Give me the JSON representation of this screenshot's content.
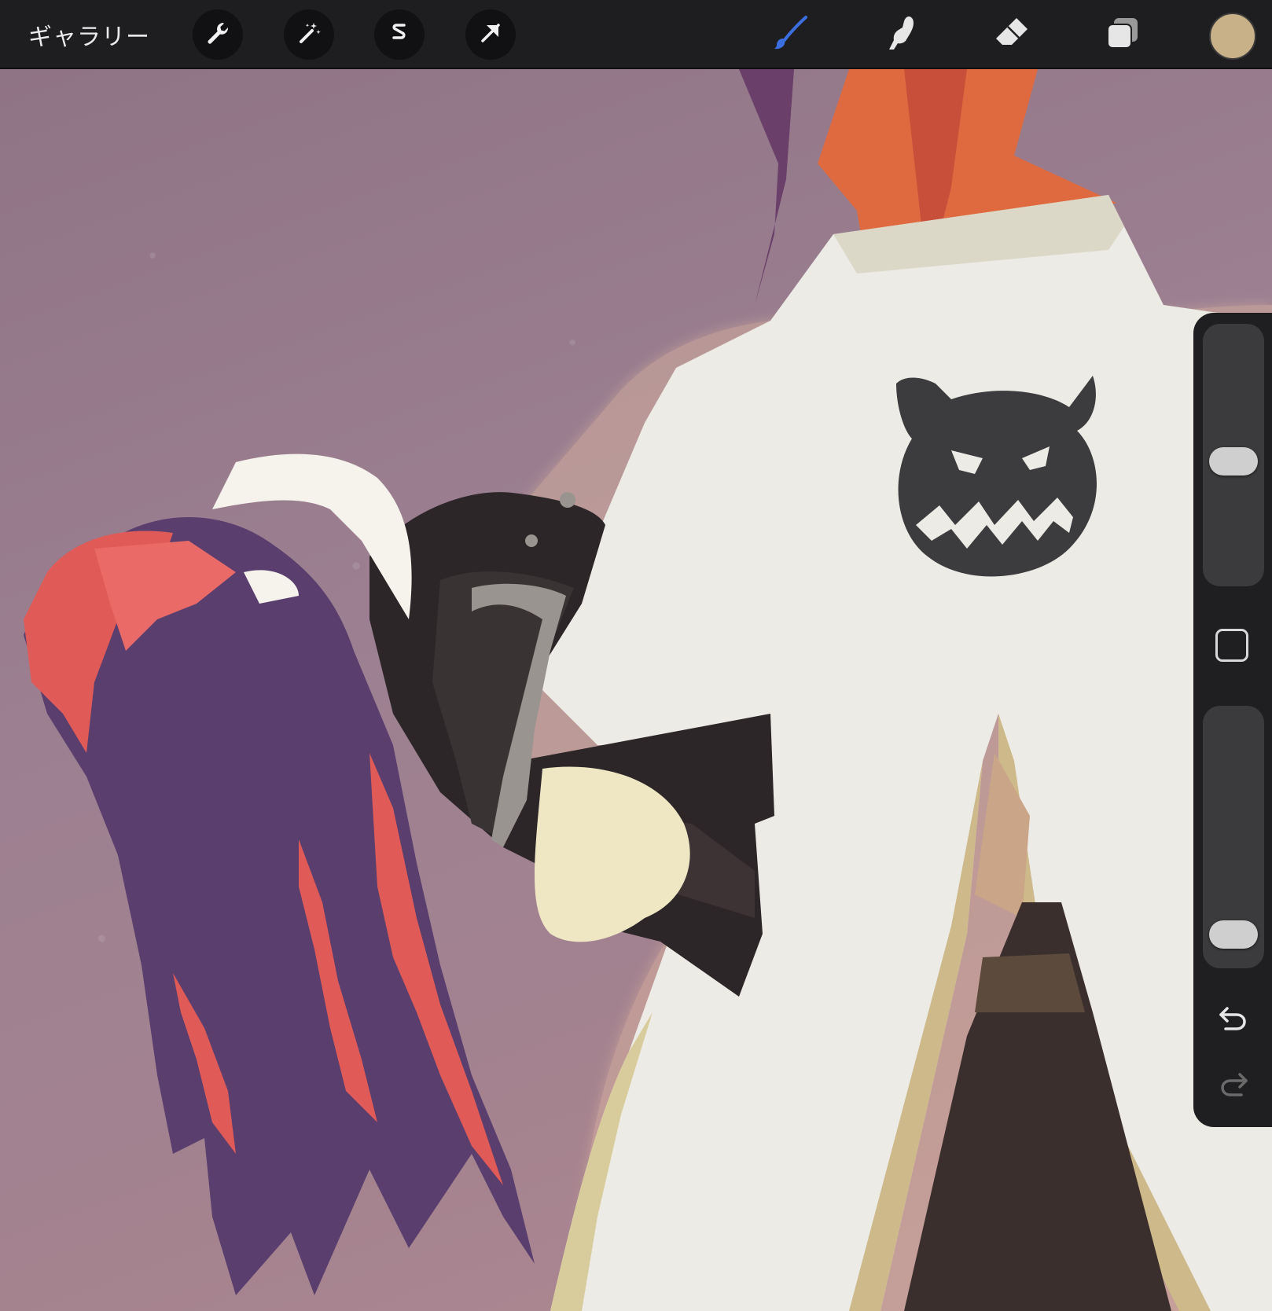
{
  "toolbar": {
    "gallery_label": "ギャラリー",
    "left_tools": [
      "wrench-icon",
      "magic-wand-icon",
      "selection-s-icon",
      "transform-arrow-icon"
    ],
    "right_tools": [
      "brush-icon",
      "smudge-icon",
      "eraser-icon",
      "layers-icon"
    ],
    "active_tool": "brush",
    "active_tool_color": "#3b6fe0",
    "current_color": "#c8b089"
  },
  "side_panel": {
    "brush_size": 0.47,
    "opacity": 0.06,
    "modify_button": "square-icon",
    "undo": "undo-icon",
    "redo": "redo-icon"
  },
  "canvas": {
    "description_colors": {
      "background": "#9c8091",
      "cloak": "#ecebe6",
      "hair_red": "#e05a57",
      "hair_purple": "#5a3f6e",
      "armor_dark": "#2c2628",
      "emblem": "#3c3b3d"
    }
  }
}
